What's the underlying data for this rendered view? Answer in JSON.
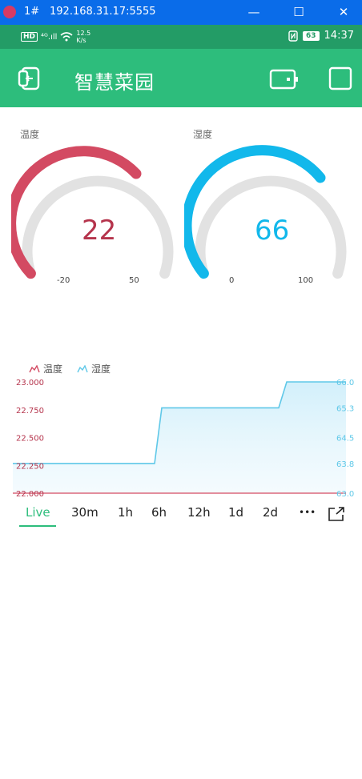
{
  "window": {
    "tab_num": "1#",
    "address": "192.168.31.17:5555",
    "minimize": "—",
    "maximize": "☐",
    "close": "✕"
  },
  "status": {
    "hd": "HD",
    "signal": "⁴ᴳ.ıll",
    "speed_value": "12.5",
    "speed_unit": "K/s",
    "battery": "63",
    "time": "14:37"
  },
  "app": {
    "title": "智慧菜园"
  },
  "gauges": [
    {
      "label": "温度",
      "value": "22",
      "min": "-20",
      "max": "50",
      "color": "#d34a62"
    },
    {
      "label": "湿度",
      "value": "66",
      "min": "0",
      "max": "100",
      "color": "#12b8eb"
    }
  ],
  "chart_data": {
    "type": "line",
    "series": [
      {
        "name": "温度",
        "color": "#d34a62",
        "axis": "left",
        "values": [
          22.0,
          22.0,
          22.0,
          22.0
        ]
      },
      {
        "name": "湿度",
        "color": "#5fc8e8",
        "axis": "right",
        "values": [
          63.8,
          63.8,
          65.3,
          66.0
        ]
      }
    ],
    "left_ticks": [
      "23.000",
      "22.750",
      "22.500",
      "22.250",
      "22.000"
    ],
    "right_ticks": [
      "66.0",
      "65.3",
      "64.5",
      "63.8",
      "63.0"
    ],
    "left_ylim": [
      22.0,
      23.0
    ],
    "right_ylim": [
      63.0,
      66.0
    ],
    "grid": false
  },
  "tabs": [
    "Live",
    "30m",
    "1h",
    "6h",
    "12h",
    "1d",
    "2d",
    "•••"
  ],
  "colors": {
    "primary": "#2dbd7c",
    "statusbar": "#239c66",
    "titlebar": "#0a6ce9"
  }
}
